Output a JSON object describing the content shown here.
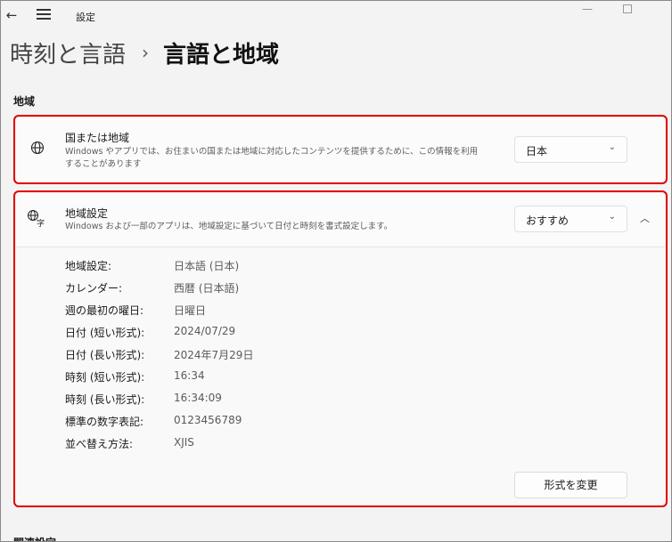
{
  "titlebar": {
    "title": "設定"
  },
  "breadcrumb": {
    "parent": "時刻と言語",
    "separator": "›",
    "current": "言語と地域"
  },
  "section": {
    "title": "地域"
  },
  "region_card": {
    "icon": "globe-icon",
    "title": "国または地域",
    "description_line1": "Windows やアプリでは、お住まいの国または地域に対応したコンテンツを提供するために、この情報を利用",
    "description_line2": "することがあります",
    "dropdown_value": "日本"
  },
  "format_card": {
    "icon": "language-region-icon",
    "title": "地域設定",
    "description": "Windows および一部のアプリは、地域設定に基づいて日付と時刻を書式設定します。",
    "dropdown_value": "おすすめ",
    "rows": [
      {
        "label": "地域設定:",
        "value": "日本語 (日本)"
      },
      {
        "label": "カレンダー:",
        "value": "西暦 (日本語)"
      },
      {
        "label": "週の最初の曜日:",
        "value": "日曜日"
      },
      {
        "label": "日付 (短い形式):",
        "value": "2024/07/29"
      },
      {
        "label": "日付 (長い形式):",
        "value": "2024年7月29日"
      },
      {
        "label": "時刻 (短い形式):",
        "value": "16:34"
      },
      {
        "label": "時刻 (長い形式):",
        "value": "16:34:09"
      },
      {
        "label": "標準の数字表記:",
        "value": "0123456789"
      },
      {
        "label": "並べ替え方法:",
        "value": "XJIS"
      }
    ],
    "change_button": "形式を変更"
  },
  "next_section": {
    "title": "関連設定"
  }
}
